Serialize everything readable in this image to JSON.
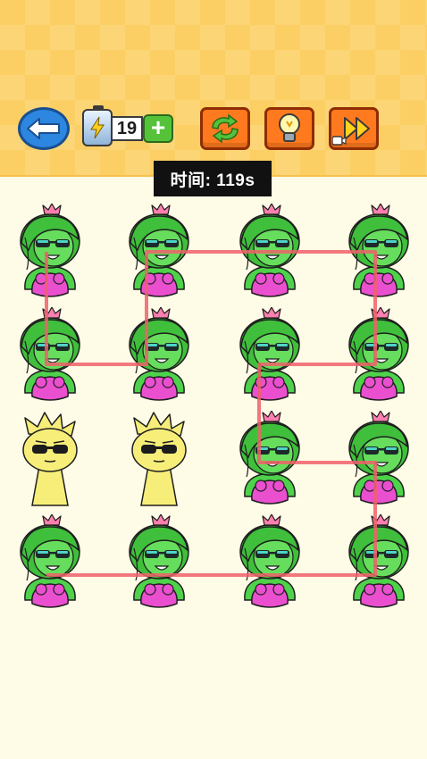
{
  "toolbar": {
    "back_icon": "back-arrow-icon",
    "energy_icon": "battery-lightning-icon",
    "energy_count": "19",
    "plus_label": "+",
    "refresh_icon": "refresh-arrows-icon",
    "hint_icon": "lightbulb-icon",
    "skip_icon": "fast-forward-video-icon"
  },
  "timer": {
    "text": "时间: 119s"
  },
  "colors": {
    "accent_orange": "#ff7a1e",
    "back_blue": "#2d86e0",
    "path_red": "#f0606a",
    "tile_green": "#4ed14b",
    "tile_pink": "#ea4fcf",
    "tile_yellow": "#f7ee7a"
  },
  "board": {
    "rows": 4,
    "cols": 4,
    "tiles": [
      [
        "green-girl",
        "green-girl",
        "green-girl",
        "green-girl"
      ],
      [
        "green-girl",
        "green-girl",
        "green-girl",
        "green-girl"
      ],
      [
        "yellow-sprunki",
        "yellow-sprunki",
        "green-girl",
        "green-girl"
      ],
      [
        "green-girl",
        "green-girl",
        "green-girl",
        "green-girl"
      ]
    ],
    "path": [
      [
        3,
        0
      ],
      [
        3,
        3
      ],
      [
        2,
        3
      ],
      [
        2,
        2
      ],
      [
        1,
        2
      ],
      [
        1,
        3
      ],
      [
        0,
        3
      ],
      [
        0,
        1
      ],
      [
        1,
        1
      ],
      [
        1,
        0
      ],
      [
        0,
        0
      ]
    ]
  }
}
